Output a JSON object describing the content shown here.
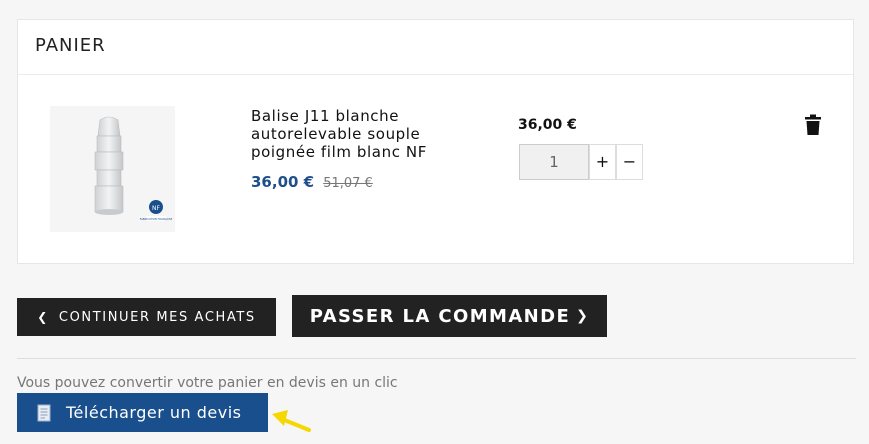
{
  "cart": {
    "title": "PANIER",
    "item": {
      "name": "Balise J11 blanche autorelevable souple poignée film blanc NF",
      "price_current": "36,00 €",
      "price_old": "51,07 €",
      "unit_total": "36,00 €",
      "quantity": "1",
      "qty_plus": "+",
      "qty_minus": "−",
      "image_badge_nf": "NF",
      "image_badge_text": "FABRICATION FRANÇAISE"
    }
  },
  "actions": {
    "continue_label": "CONTINUER MES ACHATS",
    "checkout_label": "PASSER LA COMMANDE"
  },
  "quote": {
    "info_text": "Vous pouvez convertir votre panier en devis en un clic",
    "button_label": "Télécharger un devis"
  },
  "icons": {
    "delete": "trash-icon",
    "continue": "chevron-left-icon",
    "checkout": "chevron-right-icon",
    "quote": "document-icon",
    "annotation": "arrow-pointer-icon"
  },
  "colors": {
    "accent_blue": "#1a4f8e",
    "price_blue": "#1f4f8b",
    "dark_button": "#222222",
    "annotation_yellow": "#f5d800"
  }
}
